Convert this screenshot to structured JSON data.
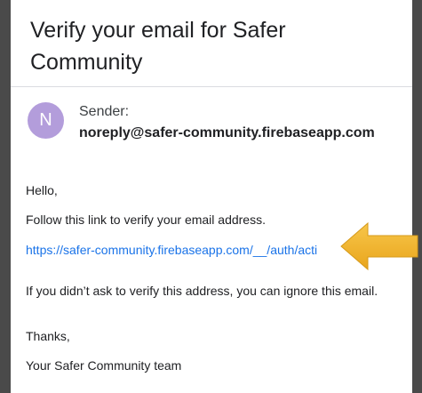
{
  "email": {
    "subject": "Verify your email for Safer Community",
    "avatar_initial": "N",
    "sender_label": "Sender:",
    "sender_address": "noreply@safer-community.firebaseapp.com",
    "greeting": "Hello,",
    "instruction": "Follow this link to verify your email address.",
    "link_text": "https://safer-community.firebaseapp.com/__/auth/acti",
    "ignore_note": "If you didn’t ask to verify this address, you can ignore this email.",
    "closing": "Thanks,",
    "signature": "Your Safer Community team"
  },
  "colors": {
    "link": "#1a73e8",
    "avatar": "#b39ddb",
    "arrow": "#f2b731"
  },
  "icons": {
    "pointer": "arrow-left-icon"
  }
}
